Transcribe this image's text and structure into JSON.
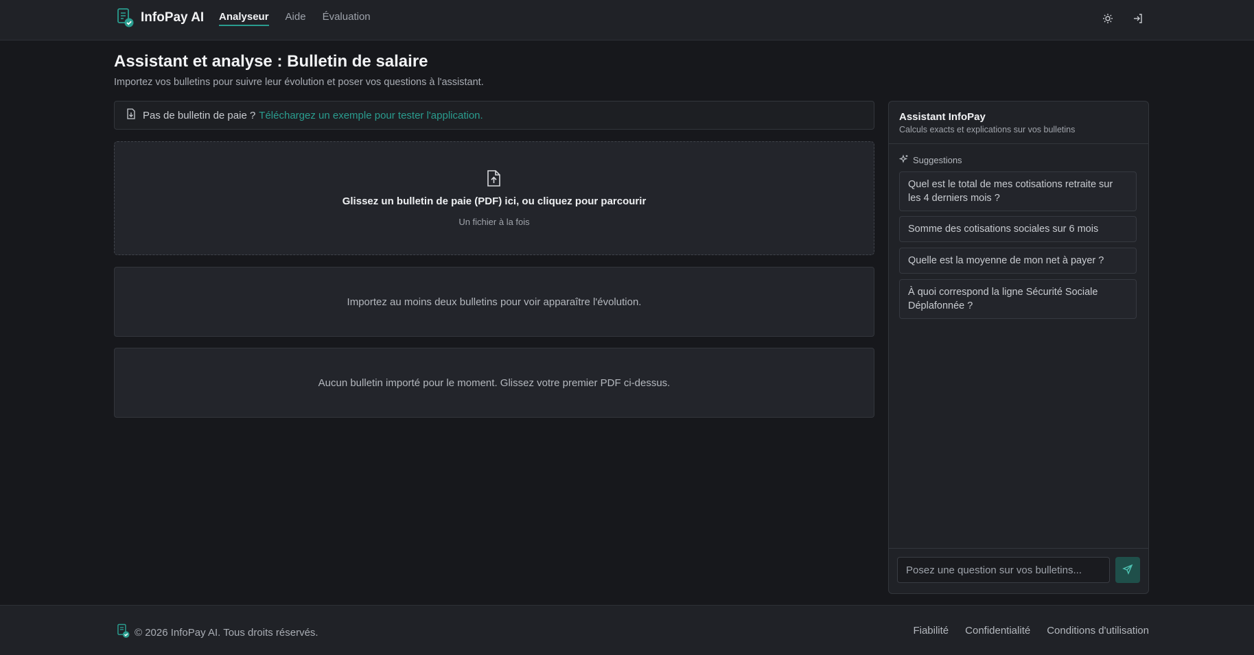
{
  "header": {
    "brand": "InfoPay AI",
    "nav": [
      {
        "label": "Analyseur",
        "active": true
      },
      {
        "label": "Aide",
        "active": false
      },
      {
        "label": "Évaluation",
        "active": false
      }
    ],
    "icons": [
      "sun-icon",
      "login-icon"
    ]
  },
  "main": {
    "title": "Assistant et analyse : Bulletin de salaire",
    "subtitle": "Importez vos bulletins pour suivre leur évolution et poser vos questions à l'assistant.",
    "sample": {
      "text": "Pas de bulletin de paie ?",
      "link": "Téléchargez un exemple pour tester l'application."
    },
    "dropzone": {
      "main": "Glissez un bulletin de paie (PDF) ici, ou cliquez pour parcourir",
      "sub": "Un fichier à la fois"
    },
    "evolution_empty": "Importez au moins deux bulletins pour voir apparaître l'évolution.",
    "list_empty": "Aucun bulletin importé pour le moment. Glissez votre premier PDF ci-dessus."
  },
  "assistant": {
    "title": "Assistant InfoPay",
    "subtitle": "Calculs exacts et explications sur vos bulletins",
    "suggestions_label": "Suggestions",
    "suggestions": [
      "Quel est le total de mes cotisations retraite sur les 4 derniers mois ?",
      "Somme des cotisations sociales sur 6 mois",
      "Quelle est la moyenne de mon net à payer ?",
      "À quoi correspond la ligne Sécurité Sociale Déplafonnée ?"
    ],
    "input_placeholder": "Posez une question sur vos bulletins..."
  },
  "footer": {
    "copyright": "© 2026 InfoPay AI. Tous droits réservés.",
    "links": [
      "Fiabilité",
      "Confidentialité",
      "Conditions d'utilisation"
    ]
  },
  "colors": {
    "accent": "#2a9d8f",
    "background": "#17181c",
    "surface": "#23252b"
  }
}
